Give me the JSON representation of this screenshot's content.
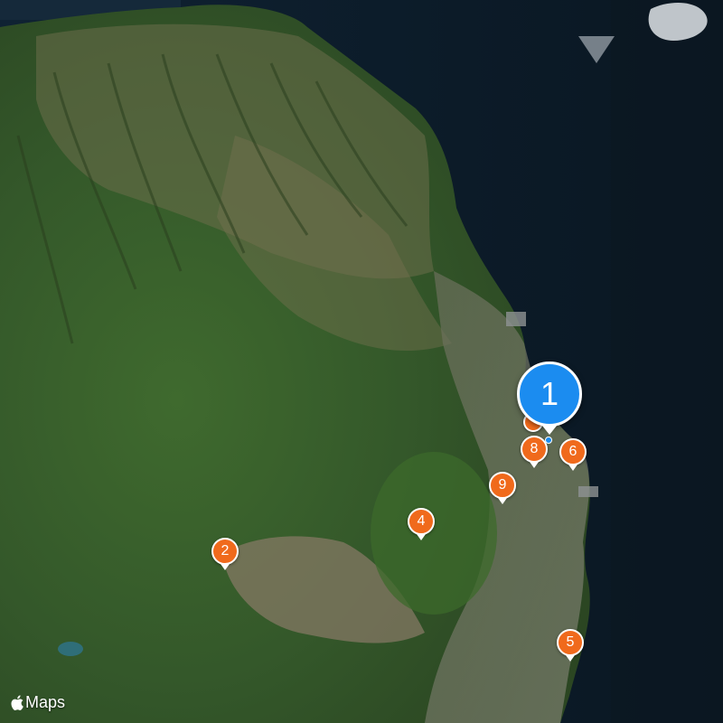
{
  "map": {
    "style": "satellite",
    "colors": {
      "pin": "#f06a1c",
      "selected_pin": "#1b8cf0",
      "pin_border": "#ffffff",
      "sea": "#0d1c2a"
    },
    "selected_marker": {
      "label": "1"
    },
    "markers": [
      {
        "label": "2"
      },
      {
        "label": "4"
      },
      {
        "label": "5"
      },
      {
        "label": "6"
      },
      {
        "label": "8"
      },
      {
        "label": "9"
      }
    ],
    "attribution": {
      "icon": "apple-logo-icon",
      "text": "Maps"
    }
  }
}
